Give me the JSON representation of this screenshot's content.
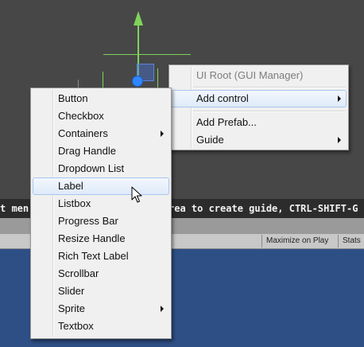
{
  "context_menu": {
    "items": [
      {
        "label": "UI Root (GUI Manager)",
        "state": "disabled",
        "has_submenu": false
      },
      {
        "label": "Add control",
        "state": "highlighted",
        "has_submenu": true
      },
      {
        "label": "Add Prefab...",
        "state": "normal",
        "has_submenu": false
      },
      {
        "label": "Guide",
        "state": "normal",
        "has_submenu": true
      }
    ]
  },
  "submenu": {
    "items": [
      {
        "label": "Button",
        "has_submenu": false
      },
      {
        "label": "Checkbox",
        "has_submenu": false
      },
      {
        "label": "Containers",
        "has_submenu": true
      },
      {
        "label": "Drag Handle",
        "has_submenu": false
      },
      {
        "label": "Dropdown List",
        "has_submenu": false
      },
      {
        "label": "Label",
        "has_submenu": false,
        "highlighted": true
      },
      {
        "label": "Listbox",
        "has_submenu": false
      },
      {
        "label": "Progress Bar",
        "has_submenu": false
      },
      {
        "label": "Resize Handle",
        "has_submenu": false
      },
      {
        "label": "Rich Text Label",
        "has_submenu": false
      },
      {
        "label": "Scrollbar",
        "has_submenu": false
      },
      {
        "label": "Slider",
        "has_submenu": false
      },
      {
        "label": "Sprite",
        "has_submenu": true
      },
      {
        "label": "Textbox",
        "has_submenu": false
      }
    ]
  },
  "hint": {
    "left_text": "t men",
    "right_text": "rea to create guide, CTRL-SHIFT-G to"
  },
  "game_toolbar": {
    "maximize_on_play": "Maximize on Play",
    "stats": "Stats"
  },
  "icons": {
    "gizmo_y": "gizmo-y-arrow-icon",
    "gizmo_pivot": "gizmo-pivot-icon",
    "cursor": "mouse-pointer-icon"
  },
  "colors": {
    "scene_bg": "#474747",
    "gizmo_green": "#7fd45a",
    "gizmo_blue": "#2f86ff",
    "menu_bg": "#f0f0f0",
    "highlight": "#dfeaf9",
    "game_bg": "#2e4f86"
  }
}
